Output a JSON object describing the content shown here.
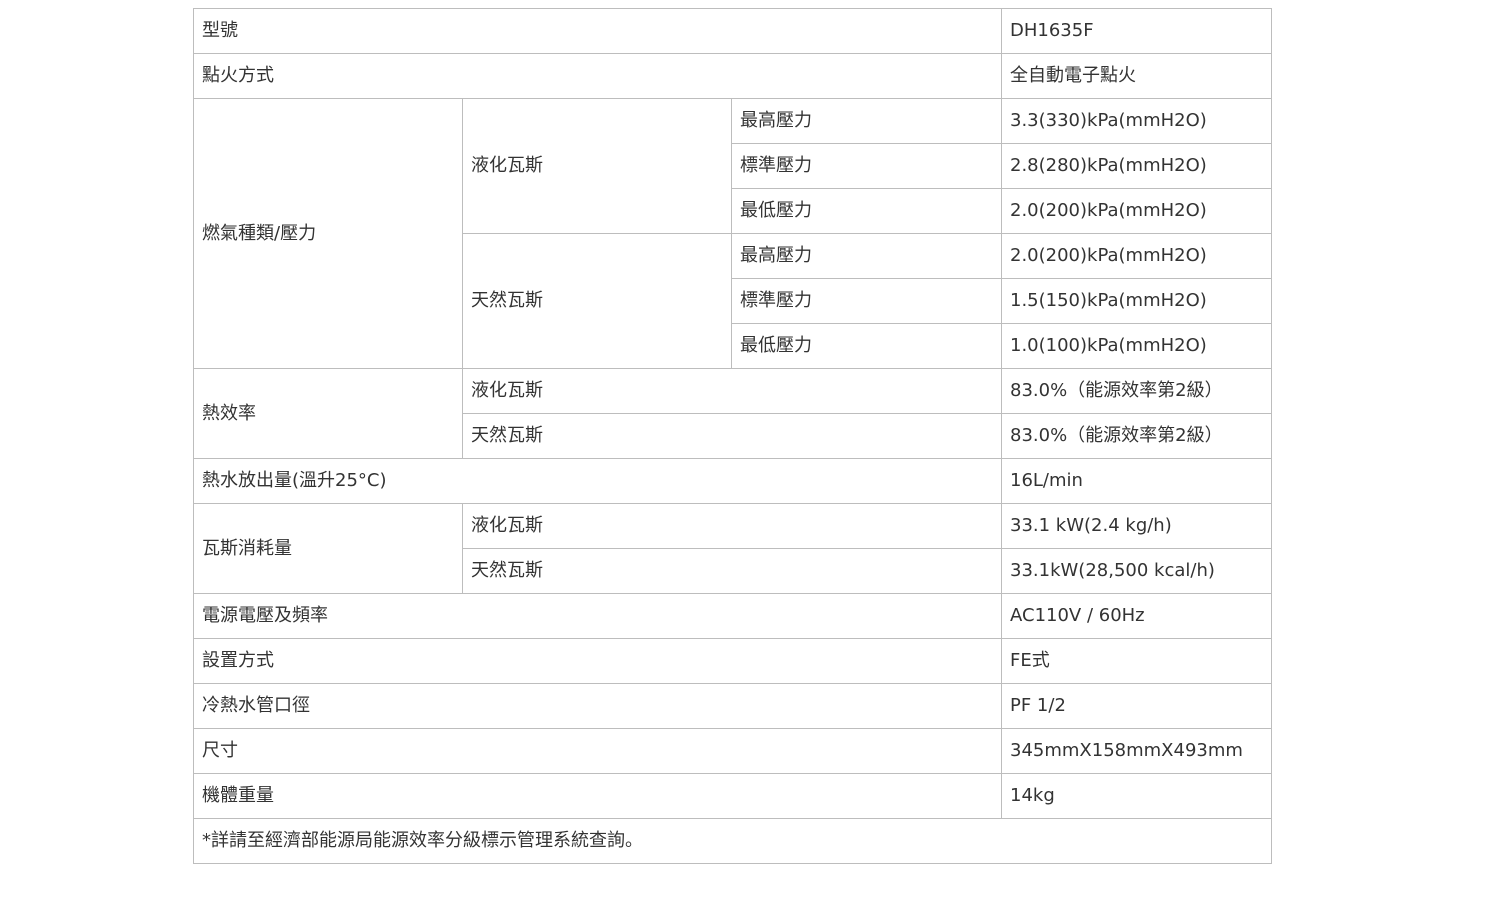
{
  "spec": {
    "model": {
      "label": "型號",
      "value": "DH1635F"
    },
    "ignition": {
      "label": "點火方式",
      "value": "全自動電子點火"
    },
    "gas_pressure": {
      "label": "燃氣種類/壓力",
      "groups": [
        {
          "name": "液化瓦斯",
          "rows": [
            {
              "label": "最高壓力",
              "value": "3.3(330)kPa(mmH2O)"
            },
            {
              "label": "標準壓力",
              "value": "2.8(280)kPa(mmH2O)"
            },
            {
              "label": "最低壓力",
              "value": "2.0(200)kPa(mmH2O)"
            }
          ]
        },
        {
          "name": "天然瓦斯",
          "rows": [
            {
              "label": "最高壓力",
              "value": "2.0(200)kPa(mmH2O)"
            },
            {
              "label": "標準壓力",
              "value": "1.5(150)kPa(mmH2O)"
            },
            {
              "label": "最低壓力",
              "value": "1.0(100)kPa(mmH2O)"
            }
          ]
        }
      ]
    },
    "thermal_efficiency": {
      "label": "熱效率",
      "rows": [
        {
          "label": "液化瓦斯",
          "value": "83.0%（能源效率第2級）"
        },
        {
          "label": "天然瓦斯",
          "value": "83.0%（能源效率第2級）"
        }
      ]
    },
    "hot_water_output": {
      "label": "熱水放出量(溫升25°C)",
      "value": "16L/min"
    },
    "gas_consumption": {
      "label": "瓦斯消耗量",
      "rows": [
        {
          "label": "液化瓦斯",
          "value": "33.1 kW(2.4 kg/h)"
        },
        {
          "label": "天然瓦斯",
          "value": "33.1kW(28,500 kcal/h)"
        }
      ]
    },
    "power": {
      "label": "電源電壓及頻率",
      "value": "AC110V / 60Hz"
    },
    "installation": {
      "label": "設置方式",
      "value": "FE式"
    },
    "pipe_diameter": {
      "label": "冷熱水管口徑",
      "value": "PF 1/2"
    },
    "dimensions": {
      "label": "尺寸",
      "value": "345mmX158mmX493mm"
    },
    "weight": {
      "label": "機體重量",
      "value": "14kg"
    },
    "note": "*詳請至經濟部能源局能源效率分級標示管理系統查詢。"
  }
}
